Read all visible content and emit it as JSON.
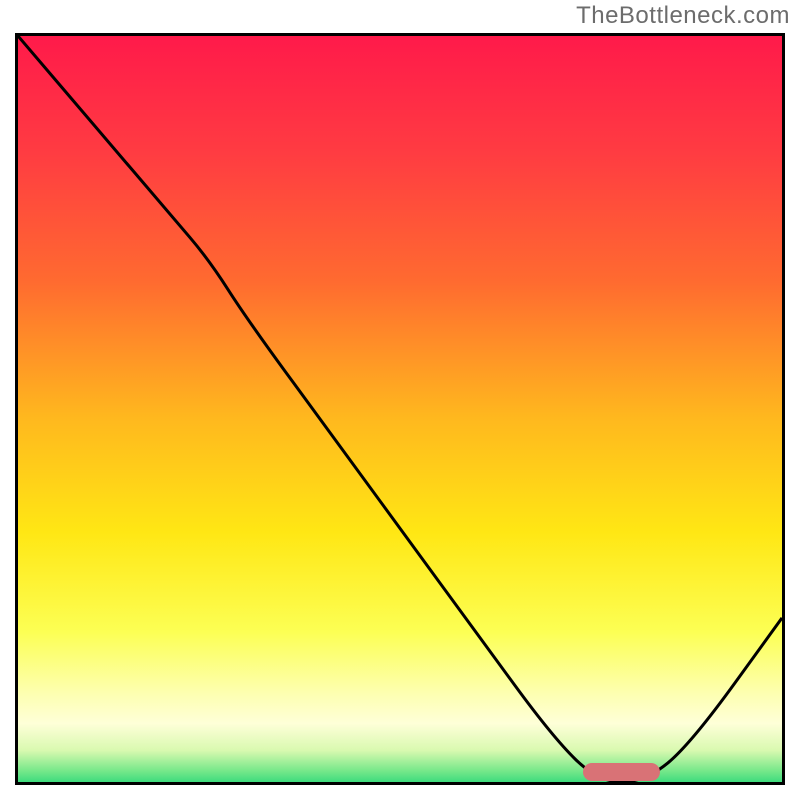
{
  "watermark": "TheBottleneck.com",
  "chart_data": {
    "type": "line",
    "title": "",
    "xlabel": "",
    "ylabel": "",
    "xlim": [
      0,
      100
    ],
    "ylim": [
      0,
      100
    ],
    "grid": false,
    "legend": false,
    "series": [
      {
        "name": "bottleneck-curve",
        "x": [
          0,
          10,
          20,
          25,
          30,
          40,
          50,
          60,
          70,
          76,
          82,
          88,
          100
        ],
        "y": [
          100,
          88,
          76,
          70,
          62,
          48,
          34,
          20,
          6,
          0,
          0,
          5,
          22
        ]
      }
    ],
    "annotations": [
      {
        "name": "optimal-range-marker",
        "type": "bar-segment",
        "x_start": 74,
        "x_end": 84,
        "y": 1,
        "color": "#d97276"
      }
    ],
    "background_gradient_stops": [
      {
        "pos": 0.0,
        "color": "#ff1a4a"
      },
      {
        "pos": 0.15,
        "color": "#ff3b42"
      },
      {
        "pos": 0.32,
        "color": "#ff6a30"
      },
      {
        "pos": 0.5,
        "color": "#ffb81e"
      },
      {
        "pos": 0.65,
        "color": "#ffe714"
      },
      {
        "pos": 0.78,
        "color": "#fcff54"
      },
      {
        "pos": 0.86,
        "color": "#fdffb0"
      },
      {
        "pos": 0.9,
        "color": "#feffd8"
      },
      {
        "pos": 0.935,
        "color": "#d9f9b0"
      },
      {
        "pos": 0.96,
        "color": "#7de98c"
      },
      {
        "pos": 0.985,
        "color": "#1ed576"
      },
      {
        "pos": 1.0,
        "color": "#09cf74"
      }
    ]
  }
}
